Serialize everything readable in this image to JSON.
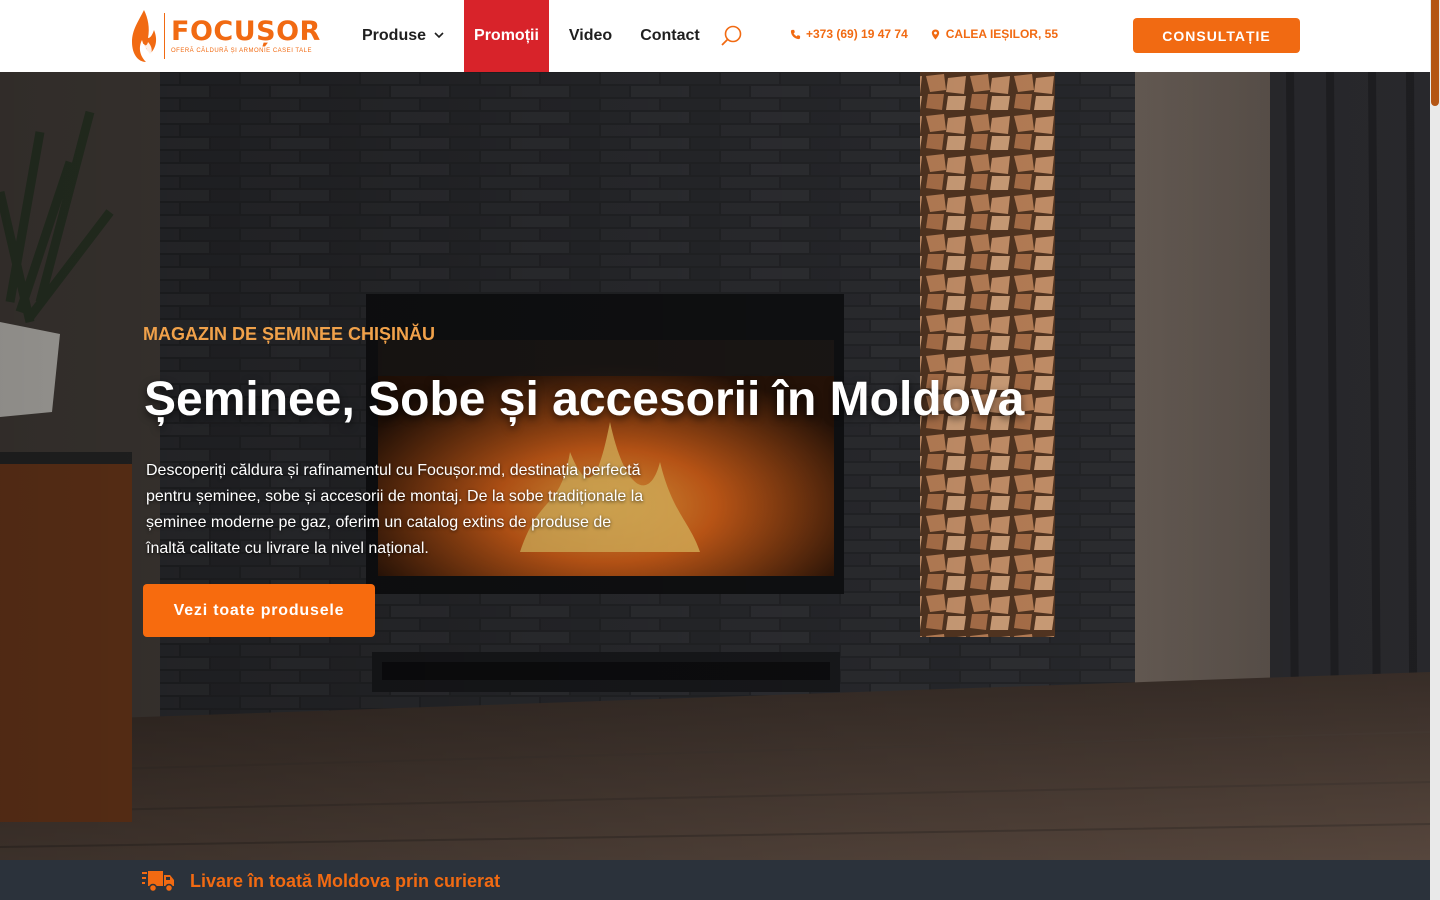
{
  "brand": {
    "name": "FOCUȘOR",
    "tagline": "OFERĂ CĂLDURĂ ȘI ARMONIE CASEI TALE",
    "accent": "#f16a12",
    "promo_bg": "#d8232a"
  },
  "nav": {
    "items": [
      {
        "label": "Produse",
        "has_dropdown": true,
        "active": false
      },
      {
        "label": "Promoții",
        "has_dropdown": false,
        "active": true
      },
      {
        "label": "Video",
        "has_dropdown": false,
        "active": false
      },
      {
        "label": "Contact",
        "has_dropdown": false,
        "active": false
      }
    ],
    "search_icon": "search-icon"
  },
  "contact": {
    "phone": "+373 (69) 19 47 74",
    "address": "CALEA IEȘILOR, 55"
  },
  "header_cta": "CONSULTAȚIE",
  "hero": {
    "eyebrow": "MAGAZIN DE ȘEMINEE CHIȘINĂU",
    "title": "Șeminee, Sobe și accesorii în Moldova",
    "text": "Descoperiți căldura și rafinamentul cu Focușor.md, destinația perfectă pentru șeminee, sobe și accesorii de montaj. De la sobe tradiționale la șeminee moderne pe gaz, oferim un catalog extins de produse de înaltă calitate cu livrare la nivel național.",
    "button": "Vezi toate produsele"
  },
  "strip": {
    "delivery": "Livare în toată Moldova prin curierat",
    "icon": "truck-icon"
  }
}
